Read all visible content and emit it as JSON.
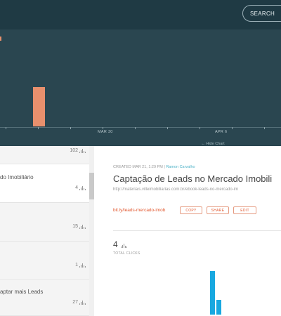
{
  "topbar": {
    "search_label": "SEARCH"
  },
  "chart": {
    "tick_labels": [
      "MAR 30",
      "APR 6"
    ],
    "hide_chart_label": "← Hide Chart",
    "bar_color": "#e8906d"
  },
  "links": [
    {
      "title": "",
      "count": "102",
      "active": false
    },
    {
      "title": "do Imobiliário",
      "count": "4",
      "active": true
    },
    {
      "title": "",
      "count": "15",
      "active": false
    },
    {
      "title": "",
      "count": "1",
      "active": false
    },
    {
      "title": "aptar mais Leads",
      "count": "27",
      "active": false
    }
  ],
  "detail": {
    "created": "CREATED MAR 21, 1:29 PM",
    "separator": " | ",
    "author": "Ramon Carvalho",
    "title": "Captação de Leads no Mercado Imobili",
    "long_url": "http://materiais.villeimobiliarias.com.br/ebook-leads-no-mercado-im",
    "short_link": "bit.ly/leads-mercado-imob",
    "copy_label": "COPY",
    "share_label": "SHARE",
    "edit_label": "EDIT",
    "total_clicks": "4",
    "total_clicks_label": "TOTAL CLICKS",
    "accent_color": "#e2582f",
    "mini_chart": {
      "type": "bar",
      "values": [
        3,
        1
      ]
    }
  }
}
